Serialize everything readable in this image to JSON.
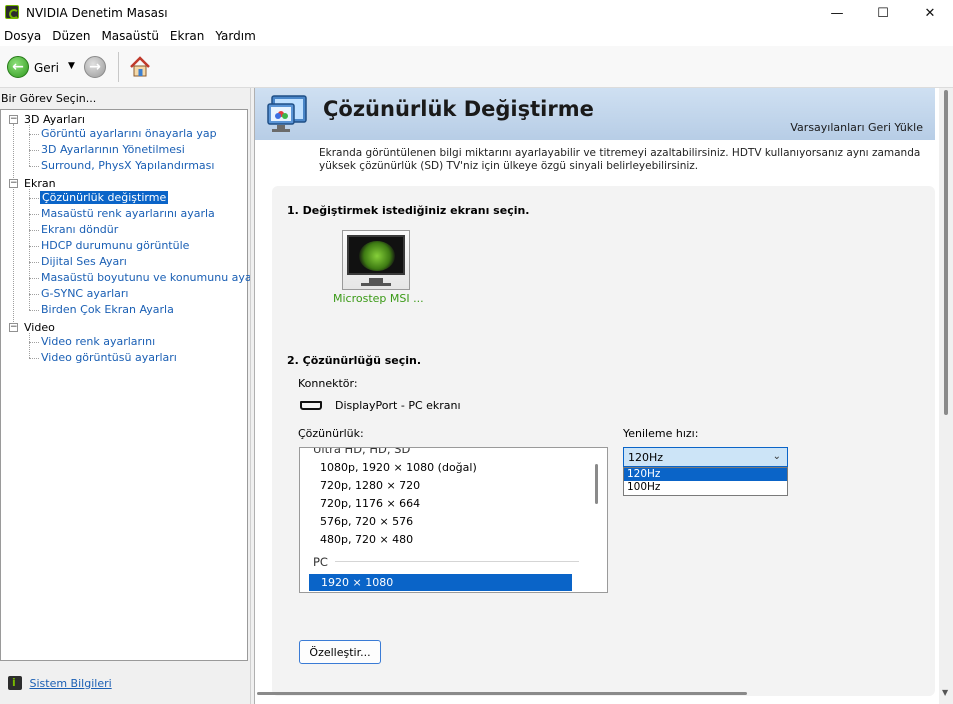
{
  "window": {
    "title": "NVIDIA Denetim Masası",
    "minimize_glyph": "—",
    "maximize_glyph": "☐",
    "close_glyph": "✕"
  },
  "menu": [
    "Dosya",
    "Düzen",
    "Masaüstü",
    "Ekran",
    "Yardım"
  ],
  "toolbar": {
    "back_label": "Geri",
    "back_glyph": "←",
    "forward_glyph": "→",
    "dropdown_glyph": "▼"
  },
  "left_panel": {
    "header": "Bir Görev Seçin...",
    "tree": [
      {
        "label": "3D Ayarları",
        "expander": "−",
        "children": [
          "Görüntü ayarlarını önayarla yap",
          "3D Ayarlarının Yönetilmesi",
          "Surround, PhysX Yapılandırması"
        ]
      },
      {
        "label": "Ekran",
        "expander": "−",
        "children": [
          "Çözünürlük değiştirme",
          "Masaüstü renk ayarlarını ayarla",
          "Ekranı döndür",
          "HDCP durumunu görüntüle",
          "Dijital Ses Ayarı",
          "Masaüstü boyutunu ve konumunu ayarla",
          "G-SYNC ayarları",
          "Birden Çok Ekran Ayarla"
        ]
      },
      {
        "label": "Video",
        "expander": "−",
        "children": [
          "Video renk ayarlarını",
          "Video görüntüsü ayarları"
        ]
      }
    ],
    "selected": "Çözünürlük değiştirme",
    "footer_link": "Sistem Bilgileri"
  },
  "page": {
    "title": "Çözünürlük Değiştirme",
    "restore_defaults": "Varsayılanları Geri Yükle",
    "description": "Ekranda görüntülenen bilgi miktarını ayarlayabilir ve titremeyi azaltabilirsiniz. HDTV kullanıyorsanız aynı zamanda yüksek çözünürlük (SD) TV'niz için ülkeye özgü sinyali belirleyebilirsiniz.",
    "step1": "1. Değiştirmek istediğiniz ekranı seçin.",
    "monitor_label": "Microstep MSI ...",
    "step2": "2. Çözünürlüğü seçin.",
    "connector_label": "Konnektör:",
    "connector_value": "DisplayPort - PC ekranı",
    "resolution_label": "Çözünürlük:",
    "refresh_label": "Yenileme hızı:",
    "resolution_list": {
      "partial_header": "Ultra HD, HD, SD",
      "hd_items": [
        "1080p, 1920 × 1080 (doğal)",
        "720p, 1280 × 720",
        "720p, 1176 × 664",
        "576p, 720 × 576",
        "480p, 720 × 480"
      ],
      "pc_header": "PC",
      "selected": "1920 × 1080"
    },
    "refresh": {
      "selected": "120Hz",
      "options": [
        "120Hz",
        "100Hz"
      ],
      "chevron": "⌄"
    },
    "customize_button": "Özelleştir..."
  }
}
